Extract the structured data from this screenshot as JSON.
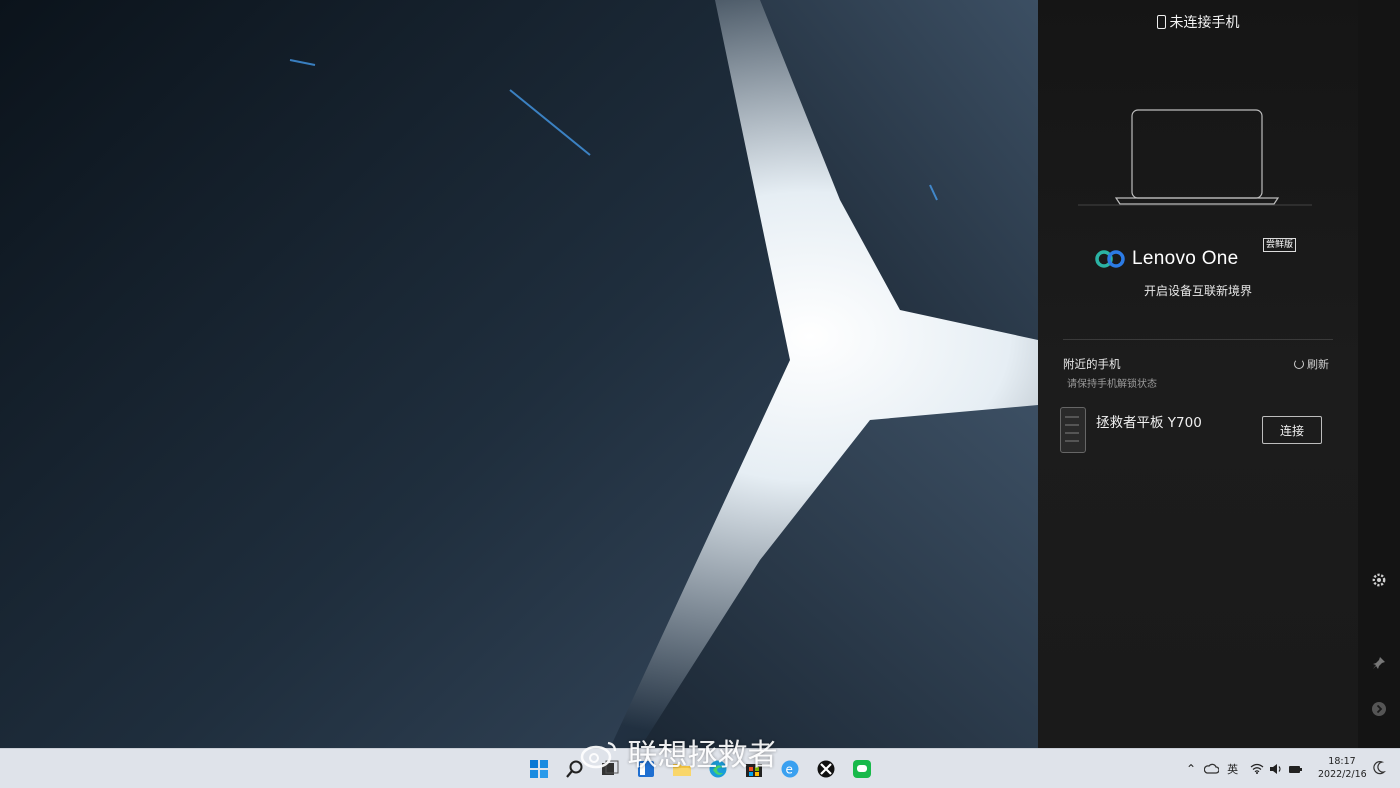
{
  "panel": {
    "status_title": "未连接手机",
    "brand_name": "Lenovo One",
    "edition_badge": "尝鲜版",
    "tagline": "开启设备互联新境界",
    "nearby": {
      "title": "附近的手机",
      "subtitle": "请保持手机解锁状态",
      "refresh_label": "刷新"
    },
    "device": {
      "name": "拯救者平板 Y700",
      "connect_label": "连接"
    }
  },
  "taskbar": {
    "input_method": "英",
    "time": "18:17",
    "date": "2022/2/16"
  },
  "watermark": "联想拯救者",
  "colors": {
    "panel_bg": "#1a1a1a",
    "brand_logo_teal": "#2bb3a4",
    "brand_logo_blue": "#2c7be5",
    "taskbar_bg": "#dfe3ea"
  }
}
